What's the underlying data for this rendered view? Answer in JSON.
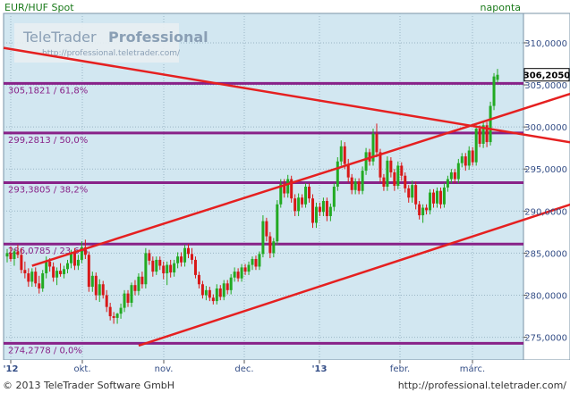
{
  "header": {
    "instrument": "EUR/HUF Spot",
    "period": "naponta"
  },
  "watermark": {
    "brand_light": "TeleTrader",
    "brand_bold": "Professional",
    "url": "http://professional.teletrader.com/"
  },
  "footer": {
    "copyright": "© 2013 TeleTrader Software GmbH",
    "url": "http://professional.teletrader.com/"
  },
  "colors": {
    "background": "#d2e7f1",
    "grid": "#9ab6c5",
    "up": "#22aa22",
    "down": "#d81818",
    "fib": "#882288",
    "trend": "#e52020",
    "text": "#334d86"
  },
  "chart_data": {
    "type": "candlestick",
    "title": "EUR/HUF Spot",
    "period": "naponta",
    "ylim": [
      272.3,
      313.5
    ],
    "y_ticks": [
      "310,0000",
      "305,0000",
      "300,0000",
      "295,0000",
      "290,0000",
      "285,0000",
      "280,0000",
      "275,0000"
    ],
    "y_tick_values": [
      310,
      305,
      300,
      295,
      290,
      285,
      280,
      275
    ],
    "x_ticks": [
      "'12",
      "okt.",
      "nov.",
      "dec.",
      "'13",
      "febr.",
      "márc."
    ],
    "last_value": 306.205,
    "last_value_label": "306,2050",
    "fib_levels": [
      {
        "value": 305.1821,
        "label": "305,1821 / 61,8%"
      },
      {
        "value": 299.2813,
        "label": "299,2813 / 50,0%"
      },
      {
        "value": 293.3805,
        "label": "293,3805 / 38,2%"
      },
      {
        "value": 286.0785,
        "label": "286,0785 / 23,6%"
      },
      {
        "value": 274.2778,
        "label": "274,2778 / 0,0%"
      }
    ],
    "trendlines": [
      {
        "from": [
          -1,
          309.4
        ],
        "to": [
          178,
          296.8
        ]
      },
      {
        "from": [
          7,
          283.5
        ],
        "to": [
          176,
          306.3
        ]
      },
      {
        "from": [
          37,
          274.0
        ],
        "to": [
          176,
          293.2
        ]
      }
    ],
    "candles": [
      {
        "o": 284.6,
        "h": 285.5,
        "l": 283.9,
        "c": 285.0
      },
      {
        "o": 285.0,
        "h": 285.8,
        "l": 284.0,
        "c": 284.3
      },
      {
        "o": 284.3,
        "h": 285.5,
        "l": 283.5,
        "c": 285.2
      },
      {
        "o": 285.2,
        "h": 286.0,
        "l": 284.4,
        "c": 284.8
      },
      {
        "o": 284.8,
        "h": 285.6,
        "l": 282.6,
        "c": 283.0
      },
      {
        "o": 283.0,
        "h": 284.0,
        "l": 282.0,
        "c": 282.6
      },
      {
        "o": 282.6,
        "h": 283.2,
        "l": 281.0,
        "c": 281.6
      },
      {
        "o": 281.6,
        "h": 283.2,
        "l": 281.0,
        "c": 282.8
      },
      {
        "o": 282.8,
        "h": 283.3,
        "l": 281.0,
        "c": 281.4
      },
      {
        "o": 281.4,
        "h": 282.3,
        "l": 280.2,
        "c": 280.8
      },
      {
        "o": 280.8,
        "h": 283.0,
        "l": 280.4,
        "c": 282.6
      },
      {
        "o": 282.6,
        "h": 284.6,
        "l": 282.0,
        "c": 284.0
      },
      {
        "o": 284.0,
        "h": 284.4,
        "l": 282.8,
        "c": 283.4
      },
      {
        "o": 283.4,
        "h": 283.9,
        "l": 281.6,
        "c": 282.1
      },
      {
        "o": 282.1,
        "h": 283.3,
        "l": 281.2,
        "c": 282.9
      },
      {
        "o": 282.9,
        "h": 283.8,
        "l": 282.2,
        "c": 282.5
      },
      {
        "o": 282.5,
        "h": 283.5,
        "l": 282.0,
        "c": 283.1
      },
      {
        "o": 283.1,
        "h": 284.2,
        "l": 282.6,
        "c": 283.8
      },
      {
        "o": 283.8,
        "h": 285.4,
        "l": 283.2,
        "c": 285.0
      },
      {
        "o": 285.0,
        "h": 285.6,
        "l": 283.0,
        "c": 283.5
      },
      {
        "o": 283.5,
        "h": 284.8,
        "l": 283.0,
        "c": 284.2
      },
      {
        "o": 284.2,
        "h": 286.4,
        "l": 283.8,
        "c": 285.7
      },
      {
        "o": 285.7,
        "h": 286.6,
        "l": 284.3,
        "c": 284.8
      },
      {
        "o": 284.8,
        "h": 285.2,
        "l": 280.4,
        "c": 281.0
      },
      {
        "o": 281.0,
        "h": 282.8,
        "l": 280.4,
        "c": 282.3
      },
      {
        "o": 282.3,
        "h": 282.7,
        "l": 279.4,
        "c": 280.0
      },
      {
        "o": 280.0,
        "h": 281.9,
        "l": 279.2,
        "c": 281.3
      },
      {
        "o": 281.3,
        "h": 281.7,
        "l": 279.6,
        "c": 280.0
      },
      {
        "o": 280.0,
        "h": 280.6,
        "l": 278.0,
        "c": 278.6
      },
      {
        "o": 278.6,
        "h": 279.1,
        "l": 277.0,
        "c": 277.5
      },
      {
        "o": 277.5,
        "h": 278.0,
        "l": 276.6,
        "c": 277.3
      },
      {
        "o": 277.3,
        "h": 277.9,
        "l": 276.6,
        "c": 277.8
      },
      {
        "o": 277.8,
        "h": 279.0,
        "l": 277.2,
        "c": 278.5
      },
      {
        "o": 278.5,
        "h": 280.6,
        "l": 278.0,
        "c": 280.2
      },
      {
        "o": 280.2,
        "h": 280.6,
        "l": 278.6,
        "c": 279.1
      },
      {
        "o": 279.1,
        "h": 281.5,
        "l": 278.6,
        "c": 281.2
      },
      {
        "o": 281.2,
        "h": 281.8,
        "l": 280.0,
        "c": 280.5
      },
      {
        "o": 280.5,
        "h": 282.6,
        "l": 280.0,
        "c": 282.2
      },
      {
        "o": 282.2,
        "h": 282.8,
        "l": 280.8,
        "c": 281.3
      },
      {
        "o": 281.3,
        "h": 285.6,
        "l": 280.8,
        "c": 285.0
      },
      {
        "o": 285.0,
        "h": 285.4,
        "l": 283.6,
        "c": 284.1
      },
      {
        "o": 284.1,
        "h": 284.6,
        "l": 282.2,
        "c": 282.8
      },
      {
        "o": 282.8,
        "h": 284.6,
        "l": 282.4,
        "c": 284.2
      },
      {
        "o": 284.2,
        "h": 284.6,
        "l": 283.0,
        "c": 283.5
      },
      {
        "o": 283.5,
        "h": 284.0,
        "l": 281.9,
        "c": 282.6
      },
      {
        "o": 282.6,
        "h": 284.0,
        "l": 281.2,
        "c": 283.6
      },
      {
        "o": 283.6,
        "h": 284.2,
        "l": 282.1,
        "c": 282.7
      },
      {
        "o": 282.7,
        "h": 284.2,
        "l": 282.2,
        "c": 283.8
      },
      {
        "o": 283.8,
        "h": 285.1,
        "l": 283.2,
        "c": 284.6
      },
      {
        "o": 284.6,
        "h": 285.1,
        "l": 283.4,
        "c": 283.9
      },
      {
        "o": 283.9,
        "h": 286.0,
        "l": 283.4,
        "c": 285.6
      },
      {
        "o": 285.6,
        "h": 286.1,
        "l": 284.4,
        "c": 284.9
      },
      {
        "o": 284.9,
        "h": 285.6,
        "l": 283.7,
        "c": 284.2
      },
      {
        "o": 284.2,
        "h": 284.6,
        "l": 282.0,
        "c": 282.4
      },
      {
        "o": 282.4,
        "h": 282.8,
        "l": 280.8,
        "c": 281.3
      },
      {
        "o": 281.3,
        "h": 281.7,
        "l": 279.6,
        "c": 280.0
      },
      {
        "o": 280.0,
        "h": 281.1,
        "l": 279.4,
        "c": 280.6
      },
      {
        "o": 280.6,
        "h": 281.0,
        "l": 279.3,
        "c": 279.7
      },
      {
        "o": 279.7,
        "h": 280.1,
        "l": 278.9,
        "c": 279.3
      },
      {
        "o": 279.3,
        "h": 281.3,
        "l": 278.9,
        "c": 280.8
      },
      {
        "o": 280.8,
        "h": 281.2,
        "l": 279.4,
        "c": 279.8
      },
      {
        "o": 279.8,
        "h": 281.8,
        "l": 279.4,
        "c": 281.4
      },
      {
        "o": 281.4,
        "h": 281.8,
        "l": 280.1,
        "c": 280.6
      },
      {
        "o": 280.6,
        "h": 282.5,
        "l": 280.1,
        "c": 282.1
      },
      {
        "o": 282.1,
        "h": 283.3,
        "l": 281.6,
        "c": 282.8
      },
      {
        "o": 282.8,
        "h": 283.2,
        "l": 281.6,
        "c": 282.0
      },
      {
        "o": 282.0,
        "h": 283.7,
        "l": 281.6,
        "c": 283.3
      },
      {
        "o": 283.3,
        "h": 283.7,
        "l": 282.4,
        "c": 282.8
      },
      {
        "o": 282.8,
        "h": 284.0,
        "l": 282.4,
        "c": 283.6
      },
      {
        "o": 283.6,
        "h": 284.6,
        "l": 283.0,
        "c": 284.3
      },
      {
        "o": 284.3,
        "h": 284.7,
        "l": 283.0,
        "c": 283.4
      },
      {
        "o": 283.4,
        "h": 285.2,
        "l": 283.0,
        "c": 284.9
      },
      {
        "o": 284.9,
        "h": 289.5,
        "l": 284.5,
        "c": 288.8
      },
      {
        "o": 288.8,
        "h": 289.2,
        "l": 286.4,
        "c": 287.0
      },
      {
        "o": 287.0,
        "h": 287.5,
        "l": 284.4,
        "c": 285.0
      },
      {
        "o": 285.0,
        "h": 286.8,
        "l": 284.5,
        "c": 286.4
      },
      {
        "o": 286.4,
        "h": 291.3,
        "l": 286.0,
        "c": 290.8
      },
      {
        "o": 290.8,
        "h": 293.8,
        "l": 290.4,
        "c": 293.2
      },
      {
        "o": 293.2,
        "h": 293.8,
        "l": 291.6,
        "c": 292.1
      },
      {
        "o": 292.1,
        "h": 294.3,
        "l": 291.6,
        "c": 293.8
      },
      {
        "o": 293.8,
        "h": 294.2,
        "l": 291.0,
        "c": 291.5
      },
      {
        "o": 291.5,
        "h": 292.0,
        "l": 289.4,
        "c": 290.0
      },
      {
        "o": 290.0,
        "h": 292.1,
        "l": 289.4,
        "c": 291.6
      },
      {
        "o": 291.6,
        "h": 292.0,
        "l": 290.4,
        "c": 290.8
      },
      {
        "o": 290.8,
        "h": 293.3,
        "l": 290.4,
        "c": 292.9
      },
      {
        "o": 292.9,
        "h": 293.3,
        "l": 291.0,
        "c": 291.5
      },
      {
        "o": 291.5,
        "h": 292.0,
        "l": 288.0,
        "c": 288.6
      },
      {
        "o": 288.6,
        "h": 291.0,
        "l": 288.0,
        "c": 290.5
      },
      {
        "o": 290.5,
        "h": 291.0,
        "l": 289.4,
        "c": 289.9
      },
      {
        "o": 289.9,
        "h": 291.6,
        "l": 289.4,
        "c": 291.2
      },
      {
        "o": 291.2,
        "h": 291.6,
        "l": 288.8,
        "c": 289.4
      },
      {
        "o": 289.4,
        "h": 290.9,
        "l": 288.8,
        "c": 290.5
      },
      {
        "o": 290.5,
        "h": 293.3,
        "l": 290.0,
        "c": 292.9
      },
      {
        "o": 292.9,
        "h": 296.4,
        "l": 292.4,
        "c": 295.9
      },
      {
        "o": 295.9,
        "h": 298.4,
        "l": 295.4,
        "c": 297.7
      },
      {
        "o": 297.7,
        "h": 298.2,
        "l": 295.0,
        "c": 295.6
      },
      {
        "o": 295.6,
        "h": 296.2,
        "l": 293.4,
        "c": 294.0
      },
      {
        "o": 294.0,
        "h": 294.4,
        "l": 292.0,
        "c": 292.5
      },
      {
        "o": 292.5,
        "h": 293.9,
        "l": 292.0,
        "c": 293.5
      },
      {
        "o": 293.5,
        "h": 293.9,
        "l": 292.0,
        "c": 292.4
      },
      {
        "o": 292.4,
        "h": 295.3,
        "l": 292.0,
        "c": 294.8
      },
      {
        "o": 294.8,
        "h": 297.5,
        "l": 294.3,
        "c": 297.0
      },
      {
        "o": 297.0,
        "h": 297.4,
        "l": 295.4,
        "c": 295.9
      },
      {
        "o": 295.9,
        "h": 299.8,
        "l": 295.4,
        "c": 299.2
      },
      {
        "o": 299.2,
        "h": 300.4,
        "l": 296.4,
        "c": 297.0
      },
      {
        "o": 297.0,
        "h": 297.4,
        "l": 293.4,
        "c": 294.0
      },
      {
        "o": 294.0,
        "h": 294.4,
        "l": 292.4,
        "c": 292.9
      },
      {
        "o": 292.9,
        "h": 296.5,
        "l": 292.4,
        "c": 296.0
      },
      {
        "o": 296.0,
        "h": 296.4,
        "l": 294.0,
        "c": 294.6
      },
      {
        "o": 294.6,
        "h": 295.0,
        "l": 292.4,
        "c": 293.0
      },
      {
        "o": 293.0,
        "h": 295.9,
        "l": 292.6,
        "c": 295.4
      },
      {
        "o": 295.4,
        "h": 295.8,
        "l": 293.6,
        "c": 294.2
      },
      {
        "o": 294.2,
        "h": 294.6,
        "l": 292.2,
        "c": 292.7
      },
      {
        "o": 292.7,
        "h": 293.1,
        "l": 291.0,
        "c": 291.6
      },
      {
        "o": 291.6,
        "h": 293.6,
        "l": 291.0,
        "c": 293.1
      },
      {
        "o": 293.1,
        "h": 293.5,
        "l": 290.2,
        "c": 290.8
      },
      {
        "o": 290.8,
        "h": 291.2,
        "l": 289.0,
        "c": 289.5
      },
      {
        "o": 289.5,
        "h": 290.8,
        "l": 288.6,
        "c": 290.4
      },
      {
        "o": 290.4,
        "h": 290.8,
        "l": 289.6,
        "c": 290.1
      },
      {
        "o": 290.1,
        "h": 292.6,
        "l": 289.6,
        "c": 292.2
      },
      {
        "o": 292.2,
        "h": 292.6,
        "l": 290.4,
        "c": 290.9
      },
      {
        "o": 290.9,
        "h": 292.8,
        "l": 290.4,
        "c": 292.4
      },
      {
        "o": 292.4,
        "h": 292.8,
        "l": 290.3,
        "c": 290.8
      },
      {
        "o": 290.8,
        "h": 293.3,
        "l": 290.4,
        "c": 292.8
      },
      {
        "o": 292.8,
        "h": 294.2,
        "l": 292.3,
        "c": 293.8
      },
      {
        "o": 293.8,
        "h": 295.0,
        "l": 293.3,
        "c": 294.6
      },
      {
        "o": 294.6,
        "h": 295.0,
        "l": 293.3,
        "c": 293.8
      },
      {
        "o": 293.8,
        "h": 296.2,
        "l": 293.3,
        "c": 295.7
      },
      {
        "o": 295.7,
        "h": 296.9,
        "l": 295.2,
        "c": 296.5
      },
      {
        "o": 296.5,
        "h": 296.9,
        "l": 294.8,
        "c": 295.4
      },
      {
        "o": 295.4,
        "h": 297.7,
        "l": 294.9,
        "c": 297.2
      },
      {
        "o": 297.2,
        "h": 297.6,
        "l": 295.4,
        "c": 295.8
      },
      {
        "o": 295.8,
        "h": 300.2,
        "l": 295.4,
        "c": 299.8
      },
      {
        "o": 299.8,
        "h": 300.2,
        "l": 297.6,
        "c": 298.0
      },
      {
        "o": 298.0,
        "h": 300.6,
        "l": 297.5,
        "c": 300.2
      },
      {
        "o": 300.2,
        "h": 300.6,
        "l": 297.6,
        "c": 298.2
      },
      {
        "o": 298.2,
        "h": 303.0,
        "l": 297.8,
        "c": 302.5
      },
      {
        "o": 302.5,
        "h": 306.4,
        "l": 302.0,
        "c": 306.0
      },
      {
        "o": 305.6,
        "h": 306.9,
        "l": 305.3,
        "c": 306.2
      }
    ]
  }
}
